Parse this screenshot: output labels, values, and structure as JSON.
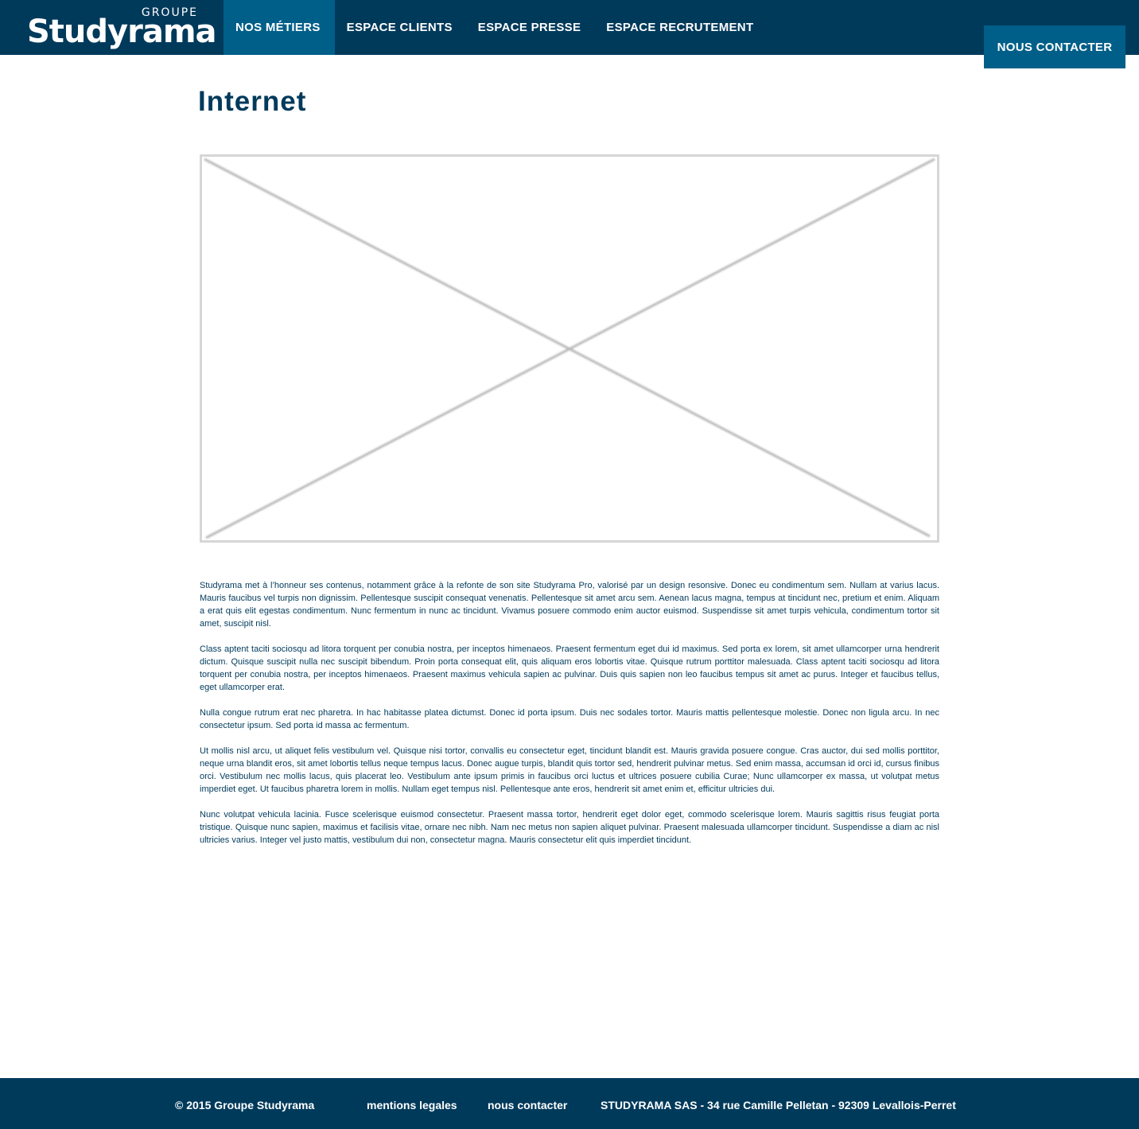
{
  "header": {
    "logo": {
      "small_text": "GROUPE",
      "brand_text": "Studyrama"
    },
    "nav": [
      {
        "label": "NOS MÉTIERS",
        "active": true
      },
      {
        "label": "ESPACE CLIENTS",
        "active": false
      },
      {
        "label": "ESPACE PRESSE",
        "active": false
      },
      {
        "label": "ESPACE RECRUTEMENT",
        "active": false
      }
    ],
    "contact_button": "NOUS CONTACTER"
  },
  "main": {
    "title": "Internet",
    "image_placeholder_icon": "image-placeholder-icon",
    "paragraphs": [
      "Studyrama met à l’honneur ses contenus, notamment grâce à la refonte de son site Studyrama Pro, valorisé par un design resonsive. Donec eu condimentum sem. Nullam at varius lacus. Mauris faucibus vel turpis non dignissim. Pellentesque suscipit consequat venenatis. Pellentesque sit amet arcu sem. Aenean lacus magna, tempus at tincidunt nec, pretium et enim. Aliquam a erat quis elit egestas condimentum. Nunc fermentum in nunc ac tincidunt. Vivamus posuere commodo enim auctor euismod. Suspendisse sit amet turpis vehicula, condimentum tortor sit amet, suscipit nisl.",
      "Class aptent taciti sociosqu ad litora torquent per conubia nostra, per inceptos himenaeos. Praesent fermentum eget dui id maximus. Sed porta ex lorem, sit amet ullamcorper urna hendrerit dictum. Quisque suscipit nulla nec suscipit bibendum. Proin porta consequat elit, quis aliquam eros lobortis vitae. Quisque rutrum porttitor malesuada. Class aptent taciti sociosqu ad litora torquent per conubia nostra, per inceptos himenaeos. Praesent maximus vehicula sapien ac pulvinar. Duis quis sapien non leo faucibus tempus sit amet ac purus. Integer et faucibus tellus, eget ullamcorper erat.",
      "Nulla congue rutrum erat nec pharetra. In hac habitasse platea dictumst. Donec id porta ipsum. Duis nec sodales tortor. Mauris mattis pellentesque molestie. Donec non ligula arcu. In nec consectetur ipsum. Sed porta id massa ac fermentum.",
      "Ut mollis nisl arcu, ut aliquet felis vestibulum vel. Quisque nisi tortor, convallis eu consectetur eget, tincidunt blandit est. Mauris gravida posuere congue. Cras auctor, dui sed mollis porttitor, neque urna blandit eros, sit amet lobortis tellus neque tempus lacus. Donec augue turpis, blandit quis tortor sed, hendrerit pulvinar metus. Sed enim massa, accumsan id orci id, cursus finibus orci. Vestibulum nec mollis lacus, quis placerat leo. Vestibulum ante ipsum primis in faucibus orci luctus et ultrices posuere cubilia Curae; Nunc ullamcorper ex massa, ut volutpat metus imperdiet eget. Ut faucibus pharetra lorem in mollis. Nullam eget tempus nisl. Pellentesque ante eros, hendrerit sit amet enim et, efficitur ultricies dui.",
      "Nunc volutpat vehicula lacinia. Fusce scelerisque euismod consectetur. Praesent massa tortor, hendrerit eget dolor eget, commodo scelerisque lorem. Mauris sagittis risus feugiat porta tristique. Quisque nunc sapien, maximus et facilisis vitae, ornare nec nibh. Nam nec metus non sapien aliquet pulvinar. Praesent malesuada ullamcorper tincidunt. Suspendisse a diam ac nisl ultricies varius. Integer vel justo mattis, vestibulum dui non, consectetur magna. Mauris consectetur elit quis imperdiet tincidunt."
    ]
  },
  "footer": {
    "copyright": "© 2015 Groupe Studyrama",
    "links": [
      "mentions legales",
      "nous contacter"
    ],
    "address": "STUDYRAMA SAS - 34 rue Camille Pelletan - 92309 Levallois-Perret"
  },
  "colors": {
    "primary_dark": "#003a5b",
    "accent": "#005f89",
    "text": "#003a5b",
    "background": "#ffffff"
  }
}
